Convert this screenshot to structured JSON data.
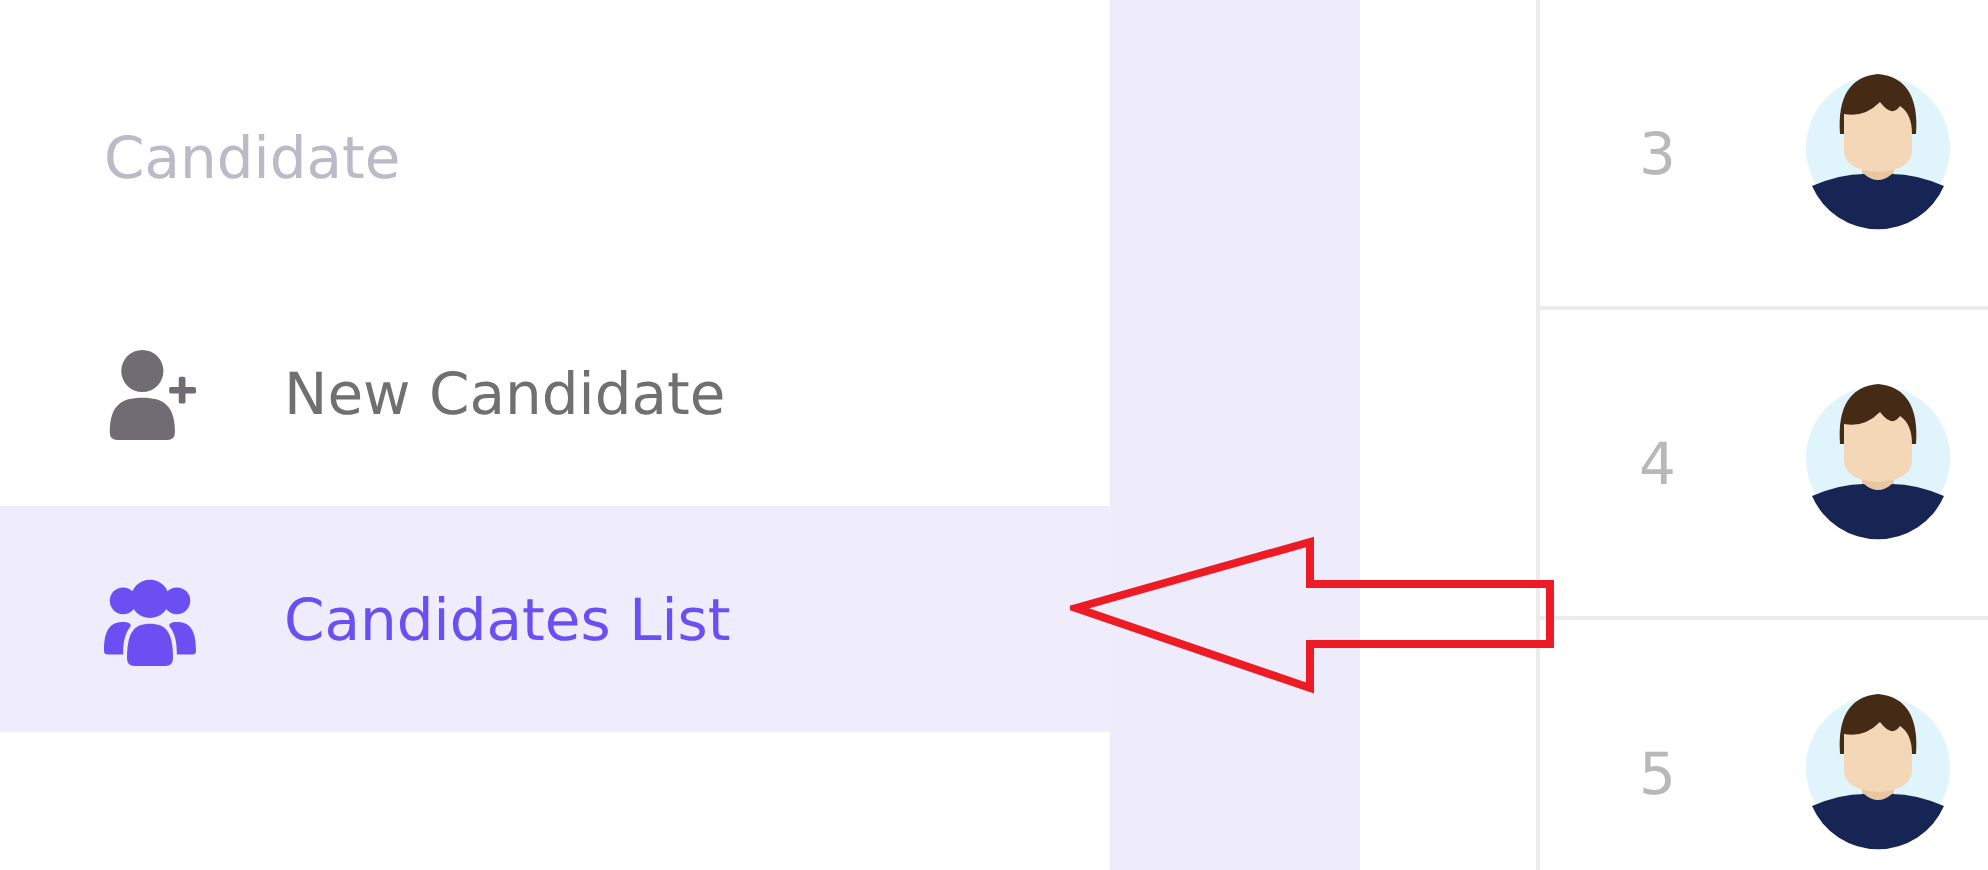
{
  "sidebar": {
    "heading": "Candidate",
    "items": [
      {
        "label": "New Candidate",
        "kind": "add-user",
        "selected": false
      },
      {
        "label": "Candidates List",
        "kind": "users",
        "selected": true
      }
    ]
  },
  "table": {
    "rows": [
      {
        "number": "3"
      },
      {
        "number": "4"
      },
      {
        "number": "5"
      }
    ]
  }
}
